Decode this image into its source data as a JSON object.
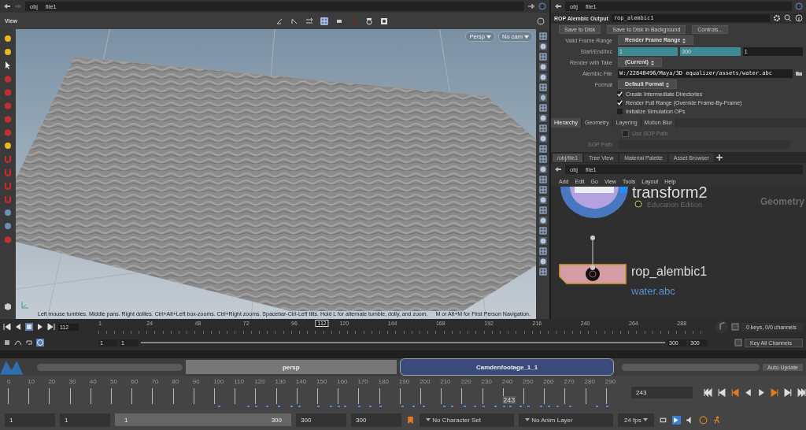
{
  "viewer": {
    "path": [
      "obj",
      "file1"
    ],
    "title": "View",
    "camera_menus": [
      "Persp",
      "No cam"
    ],
    "hint": "Left mouse tumbles. Middle pans. Right dollies. Ctrl+Alt+Left box-zooms. Ctrl+Right zooms. Spacebar-Ctrl-Left tilts. Hold L for alternate tumble, dolly, and zoom.",
    "hint_2": "M or Alt+M for First Person Navigation."
  },
  "parameters": {
    "path": [
      "obj",
      "file1"
    ],
    "node_type": "ROP Alembic Output",
    "node_name": "rop_alembic1",
    "buttons": [
      "Save to Disk",
      "Save to Disk in Background",
      "Controls..."
    ],
    "rows": [
      {
        "label": "Valid Frame Range",
        "kind": "menu",
        "value": "Render Frame Range"
      },
      {
        "label": "Start/End/Inc",
        "kind": "numbers",
        "values": [
          "1",
          "300",
          "1"
        ]
      },
      {
        "label": "Render with Take",
        "kind": "menu",
        "value": "(Current)"
      },
      {
        "label": "Alembic File",
        "kind": "file",
        "value": "W:/22840496/Maya/3D equalizer/assets/water.abc"
      },
      {
        "label": "Format",
        "kind": "menu",
        "value": "Default Format"
      }
    ],
    "toggles": [
      {
        "label": "Create Intermediate Directories",
        "checked": true
      },
      {
        "label": "Render Full Range (Override Frame-By-Frame)",
        "checked": true
      },
      {
        "label": "Initialize Simulation OPs",
        "checked": false
      }
    ],
    "tabs": [
      {
        "label": "Hierarchy",
        "selected": true
      },
      {
        "label": "Geometry",
        "selected": false
      },
      {
        "label": "Layering",
        "selected": false
      },
      {
        "label": "Motion Blur",
        "selected": false
      }
    ],
    "use_sop_path": {
      "label": "Use SOP Path",
      "checked": false
    },
    "sop_path_label": "SOP Path"
  },
  "network": {
    "tabs": [
      {
        "label": "/obj/file1",
        "selected": true
      },
      {
        "label": "Tree View",
        "selected": false
      },
      {
        "label": "Material Palette",
        "selected": false
      },
      {
        "label": "Asset Browser",
        "selected": false
      }
    ],
    "path": [
      "obj",
      "file1"
    ],
    "menu": [
      "Add",
      "Edit",
      "Go",
      "View",
      "Tools",
      "Layout",
      "Help"
    ],
    "edition": "Education Edition",
    "context": "Geometry",
    "nodes": [
      {
        "name": "transform2",
        "kind": "transform"
      },
      {
        "name": "rop_alembic1",
        "kind": "rop",
        "file": "water.abc"
      }
    ]
  },
  "timeline": {
    "frame": "112",
    "marker_frame": "112",
    "level": 0.371,
    "ticks": [
      "1",
      "24",
      "48",
      "72",
      "96",
      "120",
      "144",
      "168",
      "192",
      "216",
      "240",
      "264",
      "288"
    ],
    "range": [
      "1",
      "1",
      "300",
      "300"
    ],
    "keys_info": "0 keys, 0/0 channels",
    "key_button": "Key All Channels"
  },
  "maya": {
    "strips": [
      "persp",
      "Camdenfootage_1_1"
    ],
    "auto_update": "Auto Update",
    "ticks": [
      "0",
      "10",
      "20",
      "30",
      "40",
      "50",
      "60",
      "70",
      "80",
      "90",
      "100",
      "110",
      "120",
      "130",
      "140",
      "150",
      "160",
      "170",
      "180",
      "190",
      "200",
      "210",
      "220",
      "230",
      "240",
      "250",
      "260",
      "270",
      "280",
      "290"
    ],
    "current": "243",
    "level": 0.81,
    "current_field": "243",
    "range": [
      "1",
      "1",
      "1",
      "300",
      "300",
      "300"
    ],
    "character_set": "No Character Set",
    "anim_layer": "No Anim Layer",
    "fps": "24 fps"
  }
}
